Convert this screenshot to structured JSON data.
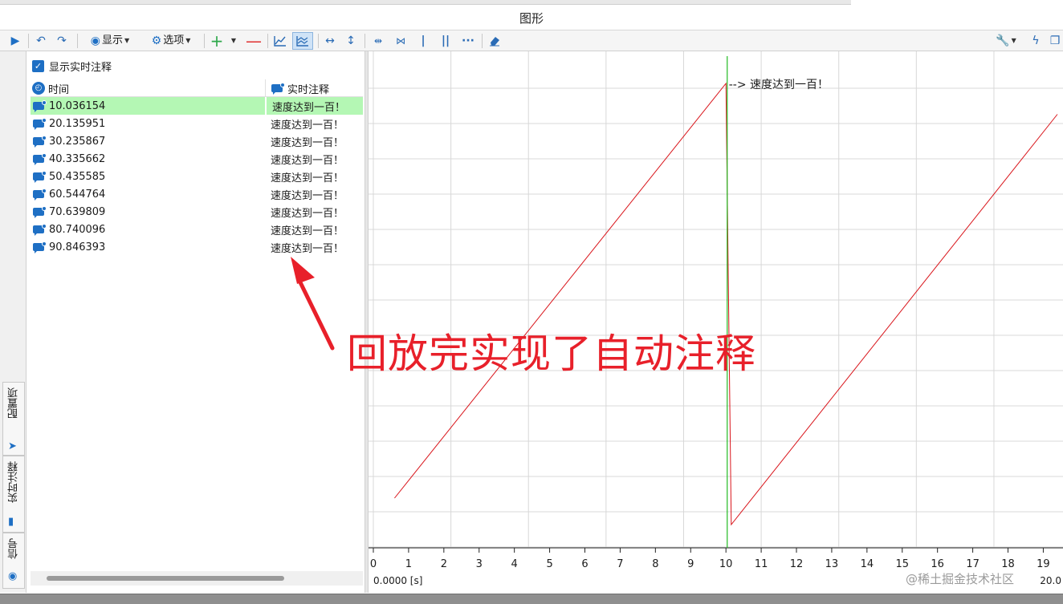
{
  "window": {
    "title": "图形"
  },
  "toolbar": {
    "display_label": "显示",
    "options_label": "选项",
    "icons": [
      "play-icon",
      "undo-icon",
      "redo-icon",
      "display-icon",
      "options-gear-icon",
      "add-icon",
      "remove-icon",
      "line-chart-icon",
      "multi-line-chart-icon",
      "fit-horizontal-icon",
      "fit-vertical-icon",
      "cursor-horizontal-icon",
      "cursor-vertical-icon",
      "bar-icon",
      "double-bar-icon",
      "more-icon",
      "eraser-icon",
      "wrench-icon",
      "lightning-icon",
      "window-icon"
    ]
  },
  "side_tabs": [
    {
      "label": "配置项",
      "icon": "config-arrow-icon"
    },
    {
      "label": "实时注释",
      "icon": "annotation-bubble-icon"
    },
    {
      "label": "信号",
      "icon": "signal-icon"
    }
  ],
  "panel": {
    "show_realtime_label": "显示实时注释",
    "show_realtime_checked": true,
    "columns": [
      "时间",
      "实时注释"
    ],
    "rows": [
      {
        "time": "10.036154",
        "note": "速度达到一百！",
        "selected": true
      },
      {
        "time": "20.135951",
        "note": "速度达到一百！"
      },
      {
        "time": "30.235867",
        "note": "速度达到一百！"
      },
      {
        "time": "40.335662",
        "note": "速度达到一百！"
      },
      {
        "time": "50.435585",
        "note": "速度达到一百！"
      },
      {
        "time": "60.544764",
        "note": "速度达到一百！"
      },
      {
        "time": "70.639809",
        "note": "速度达到一百！"
      },
      {
        "time": "80.740096",
        "note": "速度达到一百！"
      },
      {
        "time": "90.846393",
        "note": "速度达到一百！"
      }
    ]
  },
  "overlay": {
    "callout": "回放完实现了自动注释",
    "watermark": "@稀土掘金技术社区",
    "arrow_color": "#e8202a"
  },
  "chart_data": {
    "type": "line",
    "x_ticks": [
      "0",
      "1",
      "2",
      "3",
      "4",
      "5",
      "6",
      "7",
      "8",
      "9",
      "10",
      "11",
      "12",
      "13",
      "14",
      "15",
      "16",
      "17",
      "18",
      "19"
    ],
    "x_start_label": "0.0000 [s]",
    "x_end_label": "20.0",
    "xlim": [
      0,
      19.4
    ],
    "grid": true,
    "series": [
      {
        "color": "#d9151b",
        "points": [
          [
            0.6,
            6
          ],
          [
            10.0,
            100
          ],
          [
            10.15,
            0
          ],
          [
            19.4,
            93
          ]
        ]
      }
    ],
    "cursor": {
      "x": 10.036154,
      "color": "#22bb22"
    },
    "annotation": {
      "x": 10.036154,
      "text": "速度达到一百！",
      "prefix": "-->"
    }
  }
}
